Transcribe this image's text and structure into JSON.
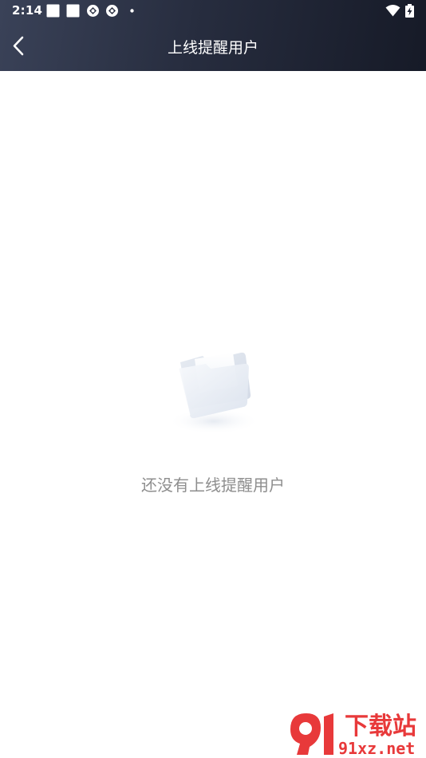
{
  "status_bar": {
    "time": "2:14"
  },
  "nav": {
    "title": "上线提醒用户"
  },
  "empty_state": {
    "message": "还没有上线提醒用户"
  },
  "watermark": {
    "brand_text": "下载站",
    "domain_text": "91xz.net"
  },
  "colors": {
    "header_start": "#3a4258",
    "header_end": "#161a27",
    "empty_text": "#8e8e8e",
    "watermark_red": "#e8393a"
  }
}
